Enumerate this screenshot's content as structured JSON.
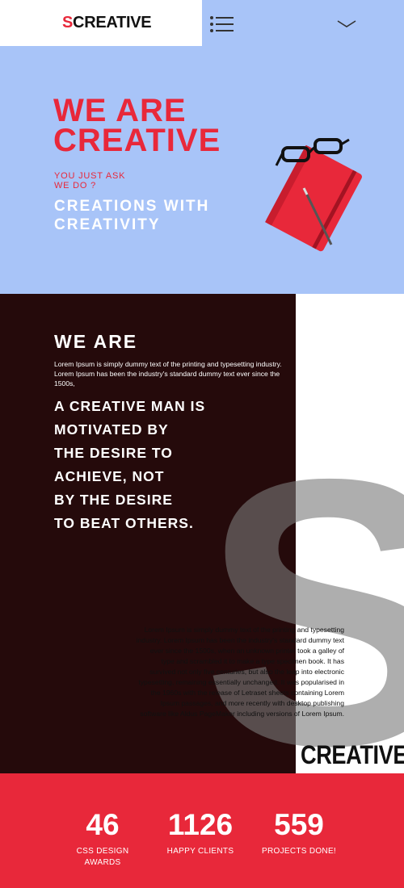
{
  "header": {
    "logo_initial": "S",
    "logo_rest": "CREATIVE",
    "menu_icon": "hamburger-menu-icon",
    "toggle_icon": "chevron-down-icon"
  },
  "hero": {
    "title_line1": "WE ARE",
    "title_line2": "CREATIVE",
    "ask_line1": "YOU JUST ASK",
    "ask_line2": "WE DO ?",
    "sub_line1": "CREATIONS WITH",
    "sub_line2": "CREATIVITY",
    "image_icon": "notebook-with-glasses-and-pen"
  },
  "about": {
    "title": "WE ARE",
    "intro": "Lorem Ipsum is simply dummy text of the printing and typesetting industry. Lorem Ipsum has been the industry's standard dummy text ever since the 1500s,",
    "quote_lines": [
      "A CREATIVE MAN IS",
      "MOTIVATED BY",
      "THE DESIRE TO",
      "ACHIEVE, NOT",
      "BY THE DESIRE",
      "TO BEAT OTHERS."
    ],
    "big_letter": "S",
    "body": "Lorem Ipsum is simply dummy text of the printing and typesetting industry. Lorem Ipsum has been the industry's standard dummy text ever since the 1500s, when an unknown printer took a galley of type and scrambled it to make a type specimen book. It has survived not only five centuries, but also the leap into electronic typesetting, remaining essentially unchanged. It was popularised in the 1960s with the release of Letraset sheets containing Lorem Ipsum passages, and more recently with desktop publishing software like Aldus PageMaker including versions of Lorem Ipsum.",
    "creative_word": "CREATIVE"
  },
  "stats": [
    {
      "number": "46",
      "label_line1": "CSS DESIGN",
      "label_line2": "AWARDS"
    },
    {
      "number": "1126",
      "label_line1": "HAPPY CLIENTS",
      "label_line2": ""
    },
    {
      "number": "559",
      "label_line1": "PROJECTS DONE!",
      "label_line2": ""
    }
  ],
  "colors": {
    "accent_red": "#e8283a",
    "hero_blue": "#a8c4f8",
    "dark_brown": "#250a0b"
  }
}
